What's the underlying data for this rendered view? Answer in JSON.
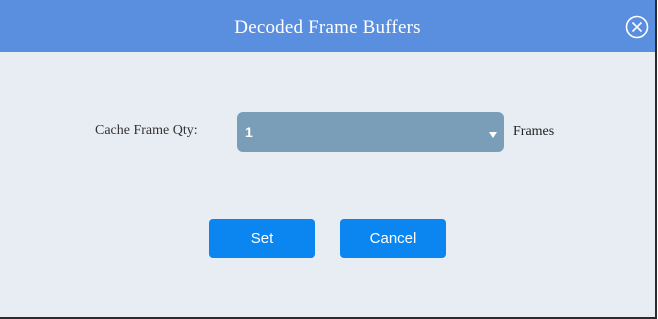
{
  "dialog": {
    "title": "Decoded Frame Buffers",
    "close_icon": "close-circle-icon",
    "accent_color": "#5a8fe0"
  },
  "form": {
    "cache_label": "Cache Frame Qty:",
    "cache_value": "1",
    "units": "Frames",
    "select_color": "#7a9db8"
  },
  "buttons": {
    "set_label": "Set",
    "cancel_label": "Cancel",
    "button_color": "#0b86f0"
  }
}
